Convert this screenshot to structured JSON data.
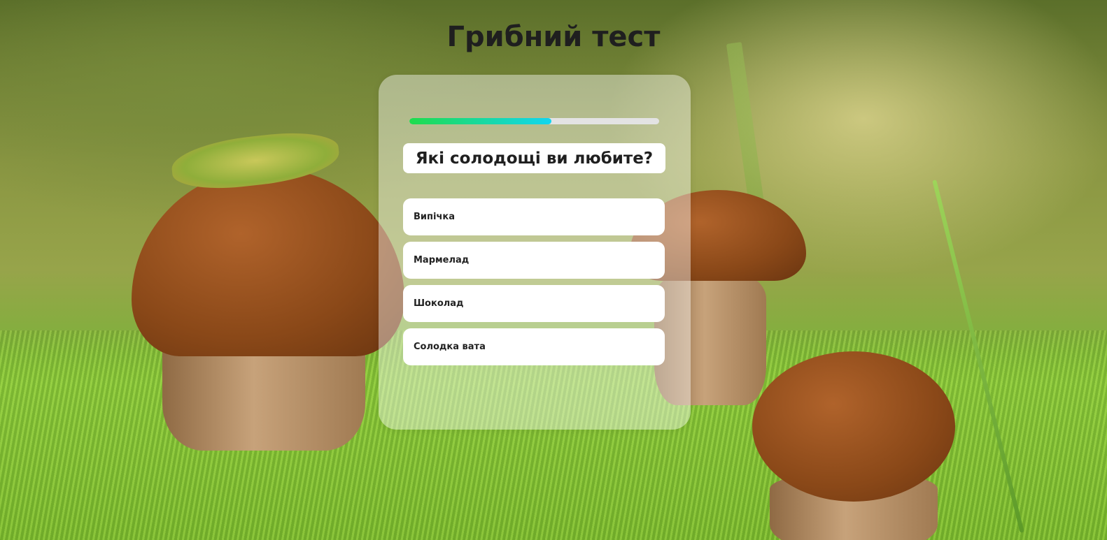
{
  "page": {
    "title": "Грибний тест"
  },
  "quiz": {
    "progress_fraction": 0.57,
    "progress_colors": [
      "#1fdc4c",
      "#12d6f0"
    ],
    "question": "Які солодощі ви любите?",
    "options": [
      {
        "label": "Випічка"
      },
      {
        "label": "Мармелад"
      },
      {
        "label": "Шоколад"
      },
      {
        "label": "Солодка вата"
      }
    ]
  }
}
